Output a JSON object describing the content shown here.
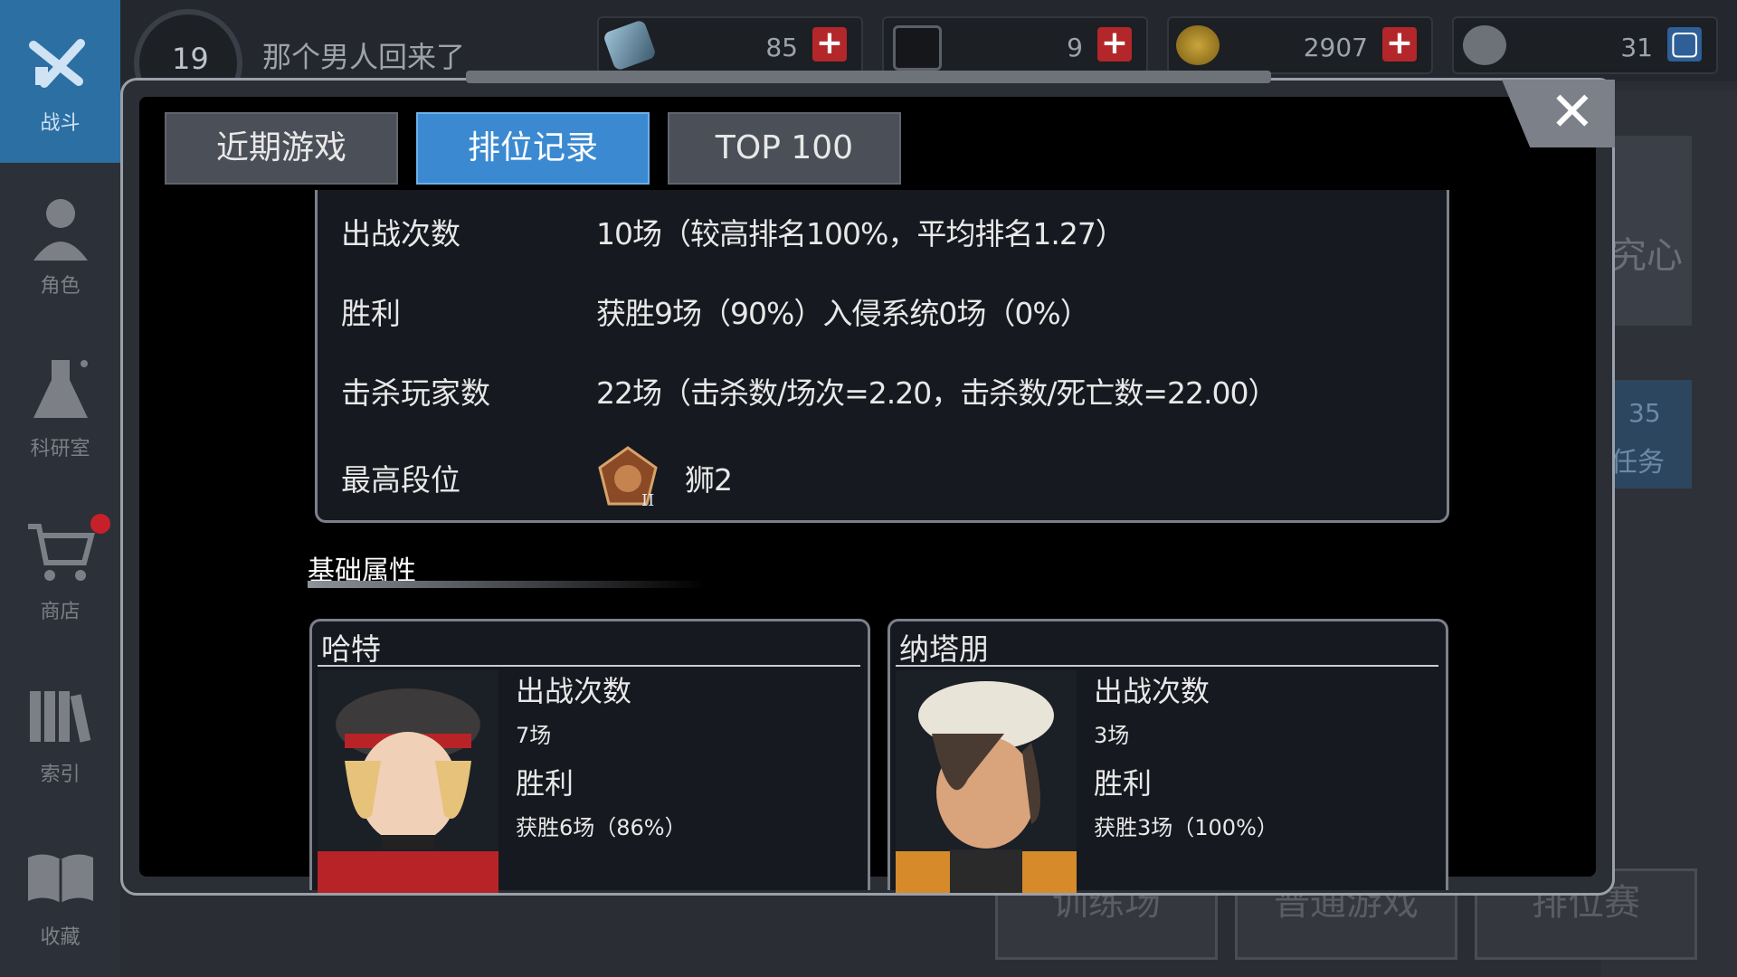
{
  "sidebar": {
    "items": [
      {
        "label": "战斗",
        "icon": "crossed-guns-icon"
      },
      {
        "label": "角色",
        "icon": "character-icon"
      },
      {
        "label": "科研室",
        "icon": "flask-icon"
      },
      {
        "label": "商店",
        "icon": "cart-icon"
      },
      {
        "label": "索引",
        "icon": "books-icon"
      },
      {
        "label": "收藏",
        "icon": "open-book-icon"
      }
    ]
  },
  "player": {
    "level": "19",
    "title": "那个男人回来了"
  },
  "resources": [
    {
      "icon": "crystal-icon",
      "value": "85"
    },
    {
      "icon": "disc-icon",
      "value": "9"
    },
    {
      "icon": "coin-icon",
      "value": "2907"
    },
    {
      "icon": "bp-icon",
      "value": "31"
    }
  ],
  "background": {
    "side_text": "35",
    "side_label": "任务",
    "side_title": "究心"
  },
  "bottom_buttons": [
    "训练场",
    "普通游戏",
    "排位赛"
  ],
  "tabs": [
    {
      "label": "近期游戏"
    },
    {
      "label": "排位记录"
    },
    {
      "label": "TOP 100"
    }
  ],
  "stats": [
    {
      "label": "出战次数",
      "value": "10场（较高排名100%，平均排名1.27）"
    },
    {
      "label": "胜利",
      "value": "获胜9场（90%）入侵系统0场（0%）"
    },
    {
      "label": "击杀玩家数",
      "value": "22场（击杀数/场次=2.20，击杀数/死亡数=22.00）"
    },
    {
      "label": "最高段位",
      "value": "狮2"
    }
  ],
  "section": {
    "title": "基础属性"
  },
  "characters": [
    {
      "name": "哈特",
      "battles_label": "出战次数",
      "battles": "7场",
      "wins_label": "胜利",
      "wins": "获胜6场（86%）"
    },
    {
      "name": "纳塔朋",
      "battles_label": "出战次数",
      "battles": "3场",
      "wins_label": "胜利",
      "wins": "获胜3场（100%）"
    }
  ],
  "colors": {
    "accent": "#3b8ad1",
    "active_nav": "#2b6fa3",
    "plus_red": "#b3262a"
  }
}
